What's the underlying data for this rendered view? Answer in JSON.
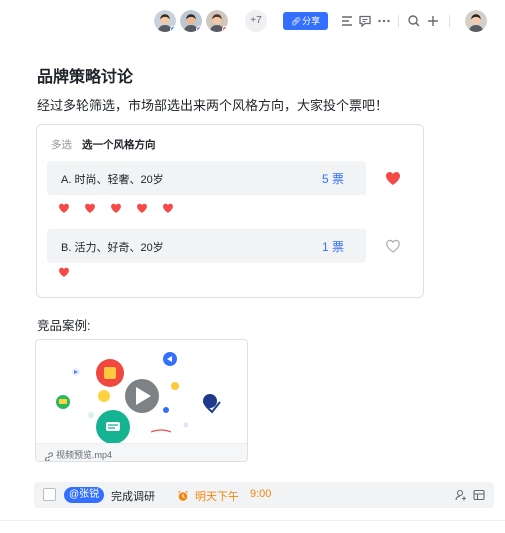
{
  "toolbar": {
    "collaborators": [
      {
        "name": "collaborator-1",
        "status_color": "#3370ff",
        "bg": "#c8d2dc",
        "skin": "#f0c9a8",
        "hair": "#3b2a22"
      },
      {
        "name": "collaborator-2",
        "status_color": "#8a5cf6",
        "bg": "#bcc7cf",
        "skin": "#e8b994",
        "hair": "#2a2a2a"
      },
      {
        "name": "collaborator-3",
        "status_color": "#f54a45",
        "bg": "#cfc6bd",
        "skin": "#f1c7a5",
        "hair": "#4b3325"
      }
    ],
    "more_count": "+7",
    "share_label": "分享",
    "icons": [
      "outline-icon",
      "comment-icon",
      "more-icon",
      "search-icon",
      "add-icon"
    ],
    "user_avatar": {
      "bg": "#d6cfc7",
      "skin": "#f2cbb0",
      "hair": "#2e211b"
    }
  },
  "doc": {
    "title": "品牌策略讨论",
    "description": "经过多轮筛选，市场部选出来两个风格方向，大家投个票吧！"
  },
  "vote": {
    "type_label": "多选",
    "question": "选一个风格方向",
    "options": [
      {
        "label": "A. 时尚、轻奢、20岁",
        "count": "5 票",
        "liked": true,
        "voters": 5
      },
      {
        "label": "B. 活力、好奇、20岁",
        "count": "1 票",
        "liked": false,
        "voters": 1
      }
    ]
  },
  "examples": {
    "label": "竞品案例:",
    "video": {
      "file_name": "视频预览.mp4"
    }
  },
  "task": {
    "mention": "@张锐",
    "text": "完成调研",
    "due_date": "明天下午",
    "due_time": "9:00"
  },
  "colors": {
    "accent": "#3370ff",
    "heart": "#f54a45",
    "due": "#f5850b"
  }
}
